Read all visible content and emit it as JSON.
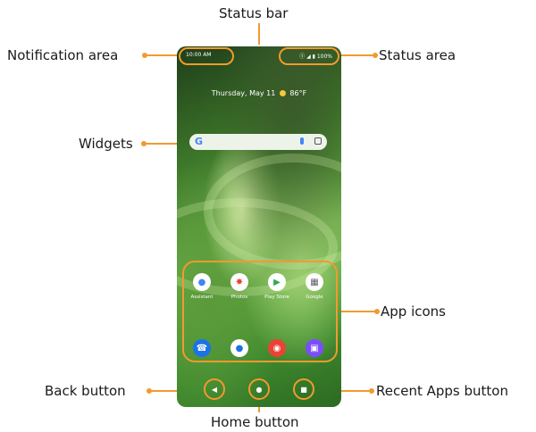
{
  "labels": {
    "status_bar": "Status bar",
    "notification_area": "Notification area",
    "status_area": "Status area",
    "widgets": "Widgets",
    "app_icons": "App icons",
    "back_button": "Back button",
    "home_button": "Home button",
    "recent_apps_button": "Recent Apps button"
  },
  "phone": {
    "time": "10:00 AM",
    "status_icons": "ⓢ ◢ ▮ 100%",
    "date": "Thursday, May 11",
    "weather": "86°F",
    "search_logo": "G",
    "apps": [
      {
        "label": "Assistant",
        "glyph": "●",
        "color": "#4285f4"
      },
      {
        "label": "Photos",
        "glyph": "✸",
        "color": "#ea4335"
      },
      {
        "label": "Play Store",
        "glyph": "▶",
        "color": "#34a853"
      },
      {
        "label": "Google",
        "glyph": "▦",
        "color": "#5f6368"
      }
    ],
    "dock": [
      {
        "name": "phone-app-icon",
        "glyph": "☎",
        "color": "#1a73e8"
      },
      {
        "name": "messages-app-icon",
        "glyph": "●",
        "color": "#ffffff"
      },
      {
        "name": "chrome-app-icon",
        "glyph": "◉",
        "color": "#ea4335"
      },
      {
        "name": "camera-app-icon",
        "glyph": "▣",
        "color": "#7c4dff"
      }
    ],
    "nav": {
      "back": "◀",
      "home": "●",
      "recent": "■"
    }
  },
  "colors": {
    "accent": "#f29a2e"
  }
}
